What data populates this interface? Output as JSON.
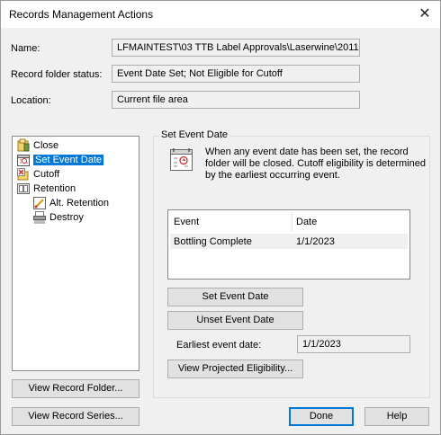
{
  "window": {
    "title": "Records Management Actions",
    "close_glyph": "✕"
  },
  "fields": {
    "name": {
      "label": "Name:",
      "value": "LFMAINTEST\\03 TTB Label Approvals\\Laserwine\\2011 -"
    },
    "status": {
      "label": "Record folder status:",
      "value": "Event Date Set; Not Eligible for Cutoff"
    },
    "location": {
      "label": "Location:",
      "value": "Current file area"
    }
  },
  "tree": {
    "items": [
      {
        "label": "Close",
        "icon": "close-folder-icon"
      },
      {
        "label": "Set Event Date",
        "icon": "calendar-icon",
        "selected": true
      },
      {
        "label": "Cutoff",
        "icon": "cutoff-icon"
      },
      {
        "label": "Retention",
        "icon": "retention-icon"
      },
      {
        "label": "Alt. Retention",
        "icon": "alt-retention-icon"
      },
      {
        "label": "Destroy",
        "icon": "shredder-icon"
      }
    ]
  },
  "panel": {
    "title": "Set Event Date",
    "description": "When any event date has been set, the record folder will be closed.  Cutoff eligibility is determined by the earliest occurring event.",
    "table": {
      "columns": [
        "Event",
        "Date"
      ],
      "rows": [
        {
          "event": "Bottling Complete",
          "date": "1/1/2023"
        }
      ]
    },
    "set_button": "Set Event Date",
    "unset_button": "Unset Event Date",
    "earliest_label": "Earliest event date:",
    "earliest_value": "1/1/2023",
    "projected_button": "View Projected Eligibility..."
  },
  "buttons": {
    "view_folder": "View Record Folder...",
    "view_series": "View Record Series...",
    "done": "Done",
    "help": "Help"
  }
}
